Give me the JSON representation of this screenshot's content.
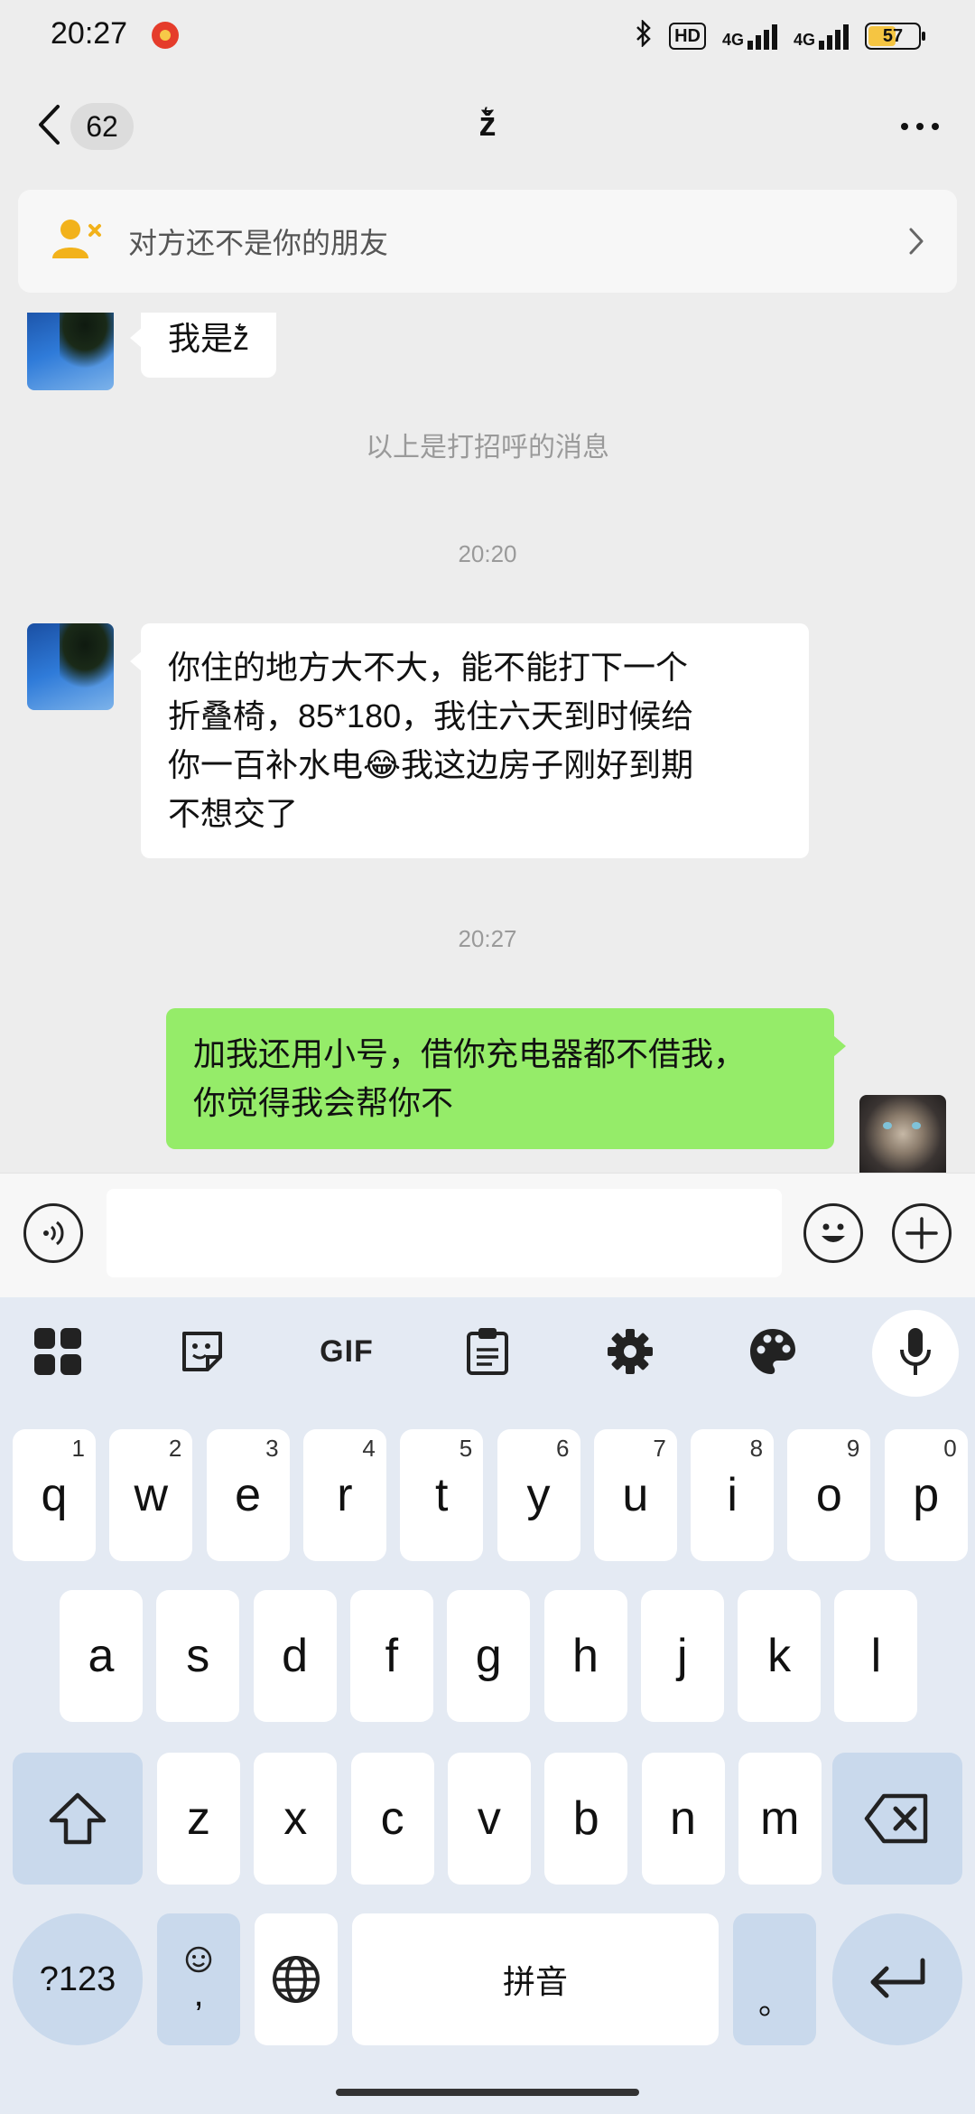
{
  "status_bar": {
    "time": "20:27",
    "hd_label": "HD",
    "net1": "4G",
    "net2": "4G",
    "battery": "57",
    "battery_level": 0.57
  },
  "header": {
    "unread_count": "62",
    "title": "ž͛"
  },
  "notice": {
    "text": "对方还不是你的朋友"
  },
  "messages": [
    {
      "side": "left",
      "text": "我是ž͛"
    },
    {
      "type": "system",
      "text": "以上是打招呼的消息"
    },
    {
      "type": "time",
      "text": "20:20"
    },
    {
      "side": "left",
      "lines": [
        "你住的地方大不大，能不能打下一个",
        "折叠椅，85*180，我住六天到时候给",
        "你一百补水电😂我这边房子刚好到期",
        "不想交了"
      ]
    },
    {
      "type": "time",
      "text": "20:27"
    },
    {
      "side": "right",
      "lines": [
        "加我还用小号，借你充电器都不借我，",
        "你觉得我会帮你不"
      ]
    }
  ],
  "input": {
    "value": "",
    "placeholder": ""
  },
  "keyboard": {
    "toolbar_gif": "GIF",
    "row1": [
      {
        "key": "q",
        "hint": "1"
      },
      {
        "key": "w",
        "hint": "2"
      },
      {
        "key": "e",
        "hint": "3"
      },
      {
        "key": "r",
        "hint": "4"
      },
      {
        "key": "t",
        "hint": "5"
      },
      {
        "key": "y",
        "hint": "6"
      },
      {
        "key": "u",
        "hint": "7"
      },
      {
        "key": "i",
        "hint": "8"
      },
      {
        "key": "o",
        "hint": "9"
      },
      {
        "key": "p",
        "hint": "0"
      }
    ],
    "row2": [
      "a",
      "s",
      "d",
      "f",
      "g",
      "h",
      "j",
      "k",
      "l"
    ],
    "row3": [
      "z",
      "x",
      "c",
      "v",
      "b",
      "n",
      "m"
    ],
    "symbols_key": "?123",
    "comma_key": ",",
    "space_label": "拼音",
    "period_key": "。"
  },
  "colors": {
    "page_bg": "#ededed",
    "bubble_right": "#95ec69",
    "bubble_left": "#ffffff",
    "keyboard_bg": "#e4eaf3",
    "key_fn": "#c9d9ec",
    "stranger_icon": "#f2b21b"
  },
  "icons": {
    "back": "chevron-left-icon",
    "more": "more-dots-icon",
    "stranger": "add-friend-icon",
    "voice": "voice-input-icon",
    "emoji": "emoji-icon",
    "plus": "plus-icon",
    "apps": "apps-grid-icon",
    "sticker": "sticker-icon",
    "clipboard": "clipboard-icon",
    "settings": "gear-icon",
    "theme": "palette-icon",
    "mic": "mic-icon",
    "shift": "shift-icon",
    "backspace": "backspace-icon",
    "globe": "globe-icon",
    "enter": "enter-icon"
  }
}
